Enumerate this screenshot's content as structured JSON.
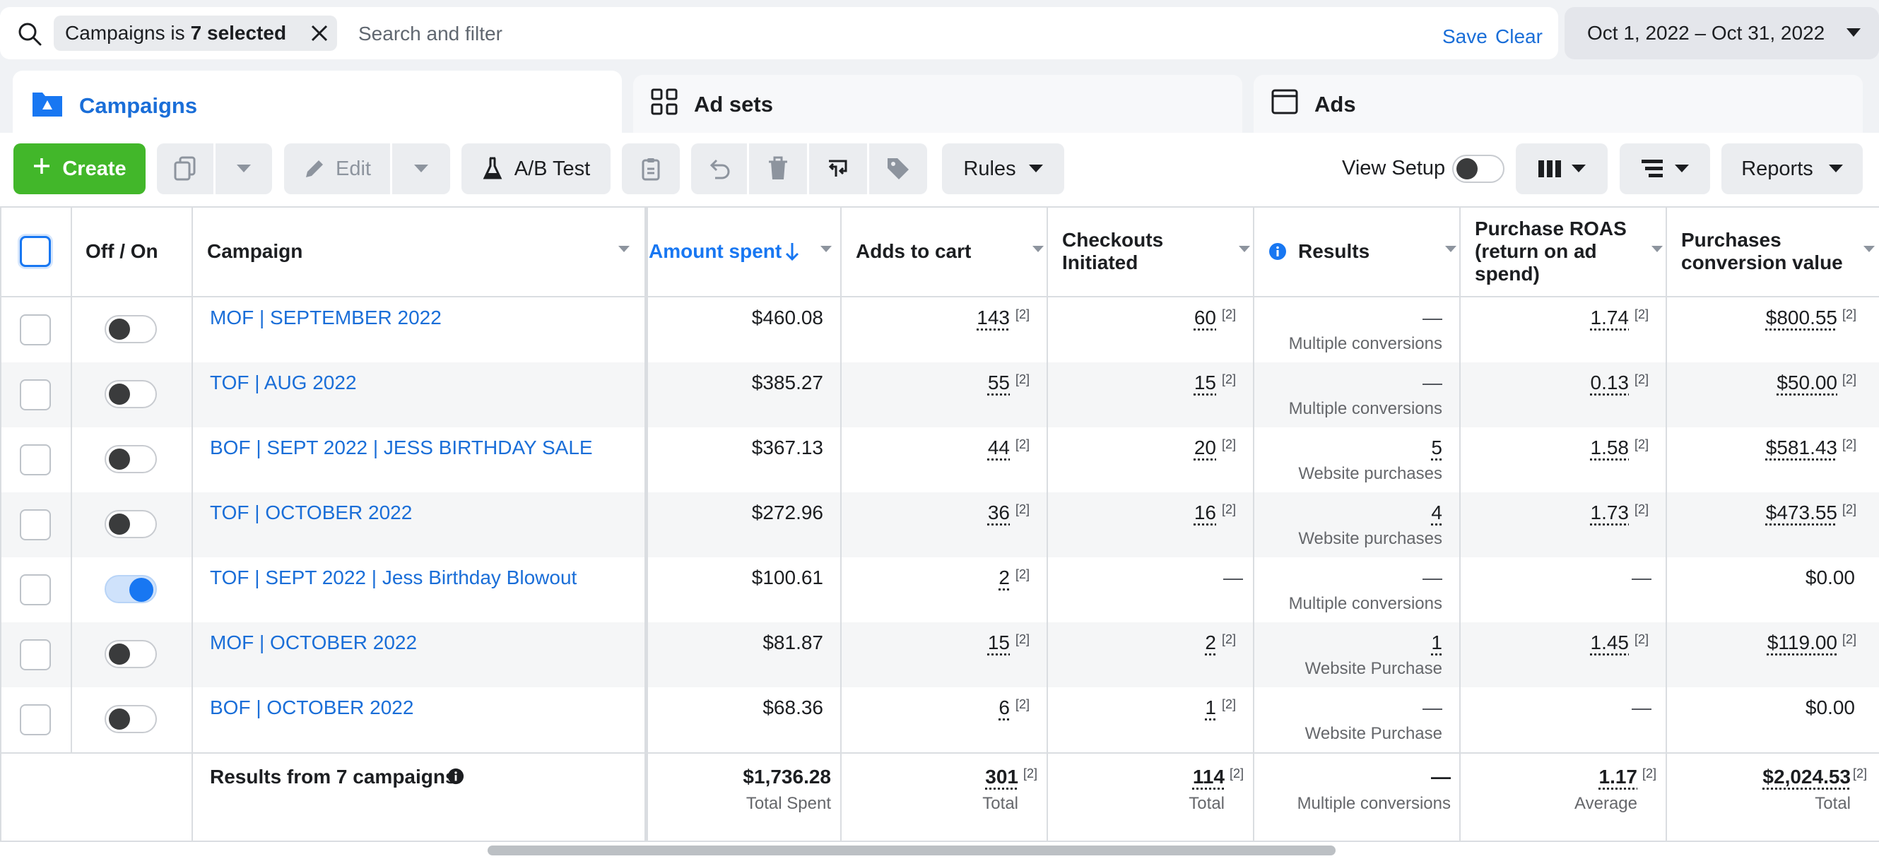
{
  "filter": {
    "chip_prefix": "Campaigns is",
    "chip_value": "7 selected",
    "placeholder": "Search and filter",
    "save": "Save",
    "clear": "Clear"
  },
  "date_range": "Oct 1, 2022 – Oct 31, 2022",
  "tabs": [
    {
      "label": "Campaigns",
      "icon": "folder-icon",
      "active": true
    },
    {
      "label": "Ad sets",
      "icon": "grid-icon",
      "active": false
    },
    {
      "label": "Ads",
      "icon": "window-icon",
      "active": false
    }
  ],
  "toolbar": {
    "create": "Create",
    "edit": "Edit",
    "ab_test": "A/B Test",
    "rules": "Rules",
    "view_setup": "View Setup",
    "reports": "Reports"
  },
  "columns": {
    "off_on": "Off / On",
    "campaign": "Campaign",
    "amount_spent": "Amount spent",
    "adds_to_cart": "Adds to cart",
    "checkouts_line1": "Checkouts",
    "checkouts_line2": "Initiated",
    "results": "Results",
    "roas_line1": "Purchase ROAS",
    "roas_line2": "(return on ad",
    "roas_line3": "spend)",
    "pcv_line1": "Purchases",
    "pcv_line2": "conversion value"
  },
  "footnote_marker": "[2]",
  "rows": [
    {
      "name": "MOF | SEPTEMBER 2022",
      "on": false,
      "spent": "$460.08",
      "atc": "143",
      "checkouts": "60",
      "result": "—",
      "result_type": "Multiple conversions",
      "roas": "1.74",
      "pcv": "$800.55"
    },
    {
      "name": "TOF | AUG 2022",
      "on": false,
      "spent": "$385.27",
      "atc": "55",
      "checkouts": "15",
      "result": "—",
      "result_type": "Multiple conversions",
      "roas": "0.13",
      "pcv": "$50.00"
    },
    {
      "name": "BOF | SEPT 2022 | JESS BIRTHDAY SALE",
      "on": false,
      "spent": "$367.13",
      "atc": "44",
      "checkouts": "20",
      "result": "5",
      "result_type": "Website purchases",
      "roas": "1.58",
      "pcv": "$581.43"
    },
    {
      "name": "TOF | OCTOBER 2022",
      "on": false,
      "spent": "$272.96",
      "atc": "36",
      "checkouts": "16",
      "result": "4",
      "result_type": "Website purchases",
      "roas": "1.73",
      "pcv": "$473.55"
    },
    {
      "name": "TOF | SEPT 2022 | Jess Birthday Blowout",
      "on": true,
      "spent": "$100.61",
      "atc": "2",
      "checkouts": "—",
      "result": "—",
      "result_type": "Multiple conversions",
      "roas": "—",
      "pcv": "$0.00"
    },
    {
      "name": "MOF | OCTOBER 2022",
      "on": false,
      "spent": "$81.87",
      "atc": "15",
      "checkouts": "2",
      "result": "1",
      "result_type": "Website Purchase",
      "roas": "1.45",
      "pcv": "$119.00"
    },
    {
      "name": "BOF | OCTOBER 2022",
      "on": false,
      "spent": "$68.36",
      "atc": "6",
      "checkouts": "1",
      "result": "—",
      "result_type": "Website Purchase",
      "roas": "—",
      "pcv": "$0.00"
    }
  ],
  "totals": {
    "label": "Results from 7 campaigns",
    "spent": "$1,736.28",
    "spent_sub": "Total Spent",
    "atc": "301",
    "atc_sub": "Total",
    "checkouts": "114",
    "checkouts_sub": "Total",
    "result": "—",
    "result_sub": "Multiple conversions",
    "roas": "1.17",
    "roas_sub": "Average",
    "pcv": "$2,024.53",
    "pcv_sub": "Total"
  },
  "colors": {
    "accent": "#1877f2",
    "link": "#1a6ed8",
    "create": "#42b72a"
  }
}
